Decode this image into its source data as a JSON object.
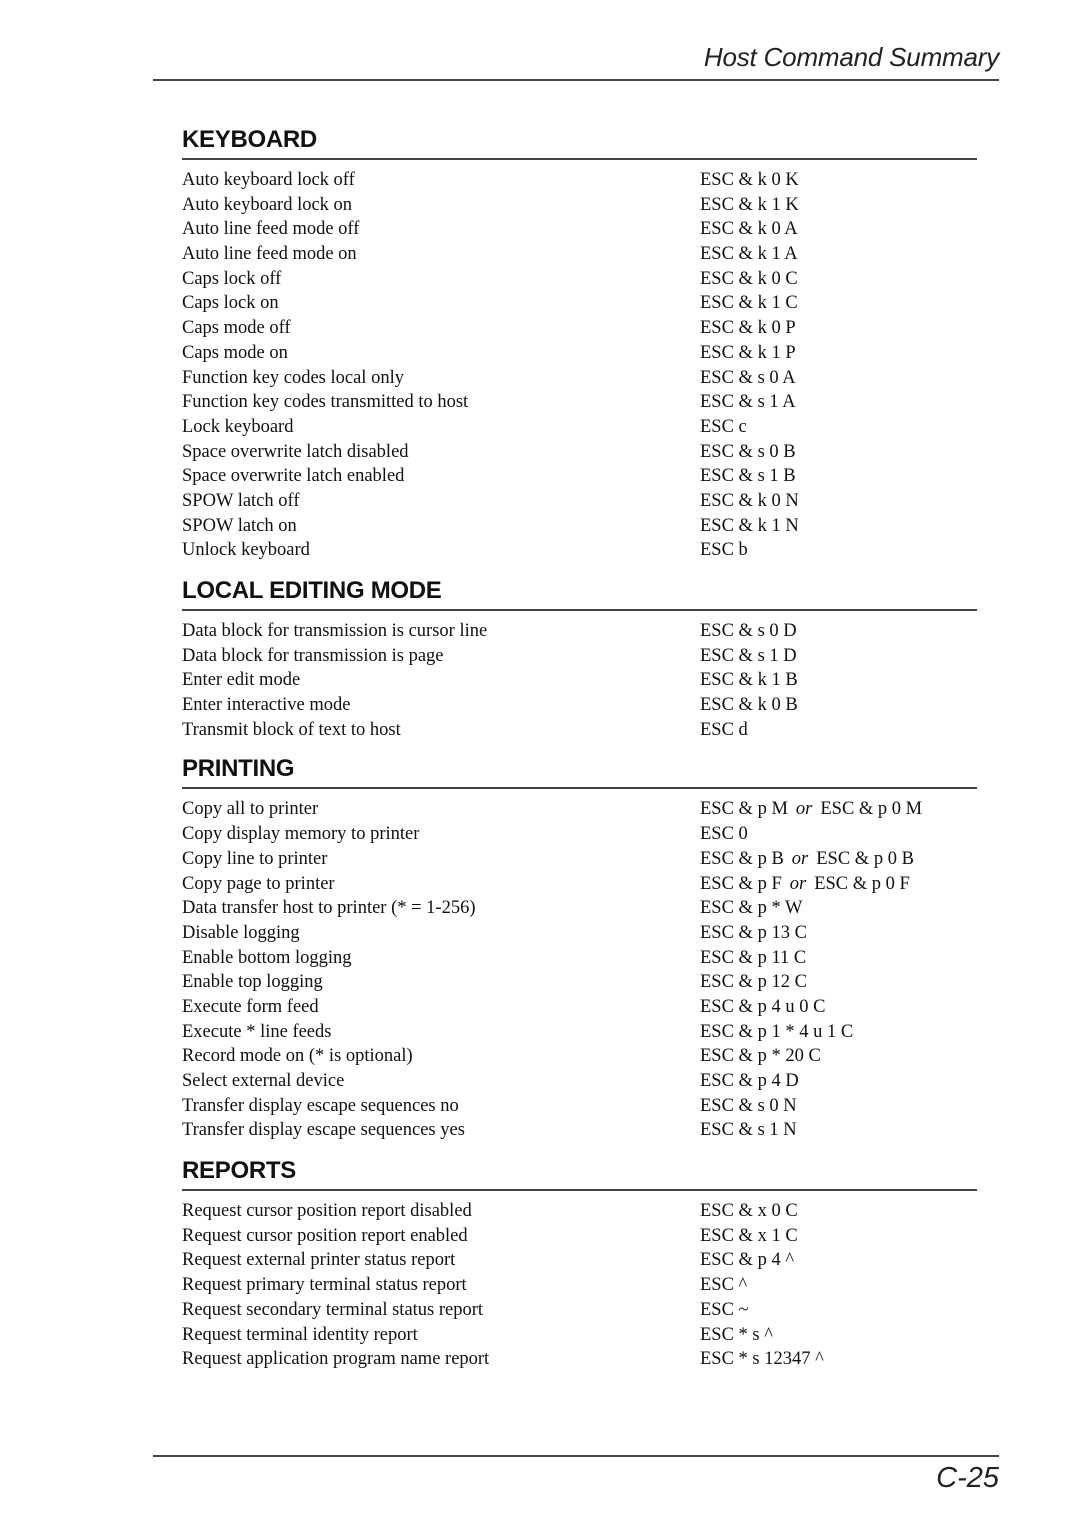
{
  "header": {
    "title": "Host Command Summary"
  },
  "footer": {
    "page_number": "C-25"
  },
  "sections": [
    {
      "title": "KEYBOARD",
      "rows": [
        {
          "desc": "Auto keyboard lock off",
          "cmd": "ESC & k 0 K"
        },
        {
          "desc": "Auto keyboard lock on",
          "cmd": "ESC & k 1 K"
        },
        {
          "desc": "Auto line feed mode off",
          "cmd": "ESC & k 0 A"
        },
        {
          "desc": "Auto line feed mode on",
          "cmd": "ESC & k 1 A"
        },
        {
          "desc": "Caps lock off",
          "cmd": "ESC & k 0 C"
        },
        {
          "desc": "Caps lock on",
          "cmd": "ESC & k 1 C"
        },
        {
          "desc": "Caps mode off",
          "cmd": "ESC & k 0 P"
        },
        {
          "desc": "Caps mode on",
          "cmd": "ESC & k 1 P"
        },
        {
          "desc": "Function key codes local only",
          "cmd": "ESC & s 0 A"
        },
        {
          "desc": "Function key codes transmitted to host",
          "cmd": "ESC & s 1 A"
        },
        {
          "desc": "Lock keyboard",
          "cmd": "ESC c"
        },
        {
          "desc": "Space overwrite latch disabled",
          "cmd": "ESC & s 0 B"
        },
        {
          "desc": "Space overwrite latch enabled",
          "cmd": "ESC & s 1 B"
        },
        {
          "desc": "SPOW latch off",
          "cmd": "ESC & k 0 N"
        },
        {
          "desc": "SPOW latch on",
          "cmd": "ESC & k 1 N"
        },
        {
          "desc": "Unlock keyboard",
          "cmd": "ESC b"
        }
      ]
    },
    {
      "title": "LOCAL EDITING MODE",
      "rows": [
        {
          "desc": "Data block for transmission is cursor line",
          "cmd": "ESC & s 0 D"
        },
        {
          "desc": "Data block for transmission is page",
          "cmd": "ESC & s 1 D"
        },
        {
          "desc": "Enter edit mode",
          "cmd": "ESC & k 1 B"
        },
        {
          "desc": "Enter interactive mode",
          "cmd": "ESC & k 0 B"
        },
        {
          "desc": "Transmit block of text to host",
          "cmd": "ESC d"
        }
      ]
    },
    {
      "title": "PRINTING",
      "rows": [
        {
          "desc": "Copy all to printer",
          "cmd": "ESC & p M",
          "or": "or",
          "alt": "ESC & p 0 M"
        },
        {
          "desc": "Copy display memory to printer",
          "cmd": "ESC 0"
        },
        {
          "desc": "Copy line to printer",
          "cmd": "ESC & p B",
          "or": "or",
          "alt": "ESC & p 0 B"
        },
        {
          "desc": "Copy page to printer",
          "cmd": "ESC & p F",
          "or": "or",
          "alt": "ESC & p 0 F"
        },
        {
          "desc": "Data transfer host to printer (* = 1-256)",
          "cmd": "ESC & p * W"
        },
        {
          "desc": "Disable logging",
          "cmd": "ESC & p 13 C"
        },
        {
          "desc": "Enable bottom logging",
          "cmd": "ESC & p 11 C"
        },
        {
          "desc": "Enable top logging",
          "cmd": "ESC & p 12 C"
        },
        {
          "desc": "Execute form feed",
          "cmd": "ESC & p 4 u 0 C"
        },
        {
          "desc": "Execute * line feeds",
          "cmd": "ESC & p 1 * 4 u 1 C"
        },
        {
          "desc": "Record mode on (* is optional)",
          "cmd": "ESC & p * 20 C"
        },
        {
          "desc": "Select external device",
          "cmd": "ESC & p 4 D"
        },
        {
          "desc": "Transfer display escape sequences no",
          "cmd": "ESC & s 0 N"
        },
        {
          "desc": "Transfer display escape sequences yes",
          "cmd": "ESC & s 1 N"
        }
      ]
    },
    {
      "title": "REPORTS",
      "rows": [
        {
          "desc": "Request cursor position report disabled",
          "cmd": "ESC & x 0 C"
        },
        {
          "desc": "Request cursor position report enabled",
          "cmd": "ESC & x 1 C"
        },
        {
          "desc": "Request external printer status report",
          "cmd": "ESC & p 4 ^"
        },
        {
          "desc": "Request primary terminal status report",
          "cmd": "ESC ^"
        },
        {
          "desc": "Request secondary terminal status report",
          "cmd": "ESC ~"
        },
        {
          "desc": "Request terminal identity report",
          "cmd": "ESC * s ^"
        },
        {
          "desc": "Request application program name report",
          "cmd": "ESC * s 12347 ^"
        }
      ]
    }
  ]
}
